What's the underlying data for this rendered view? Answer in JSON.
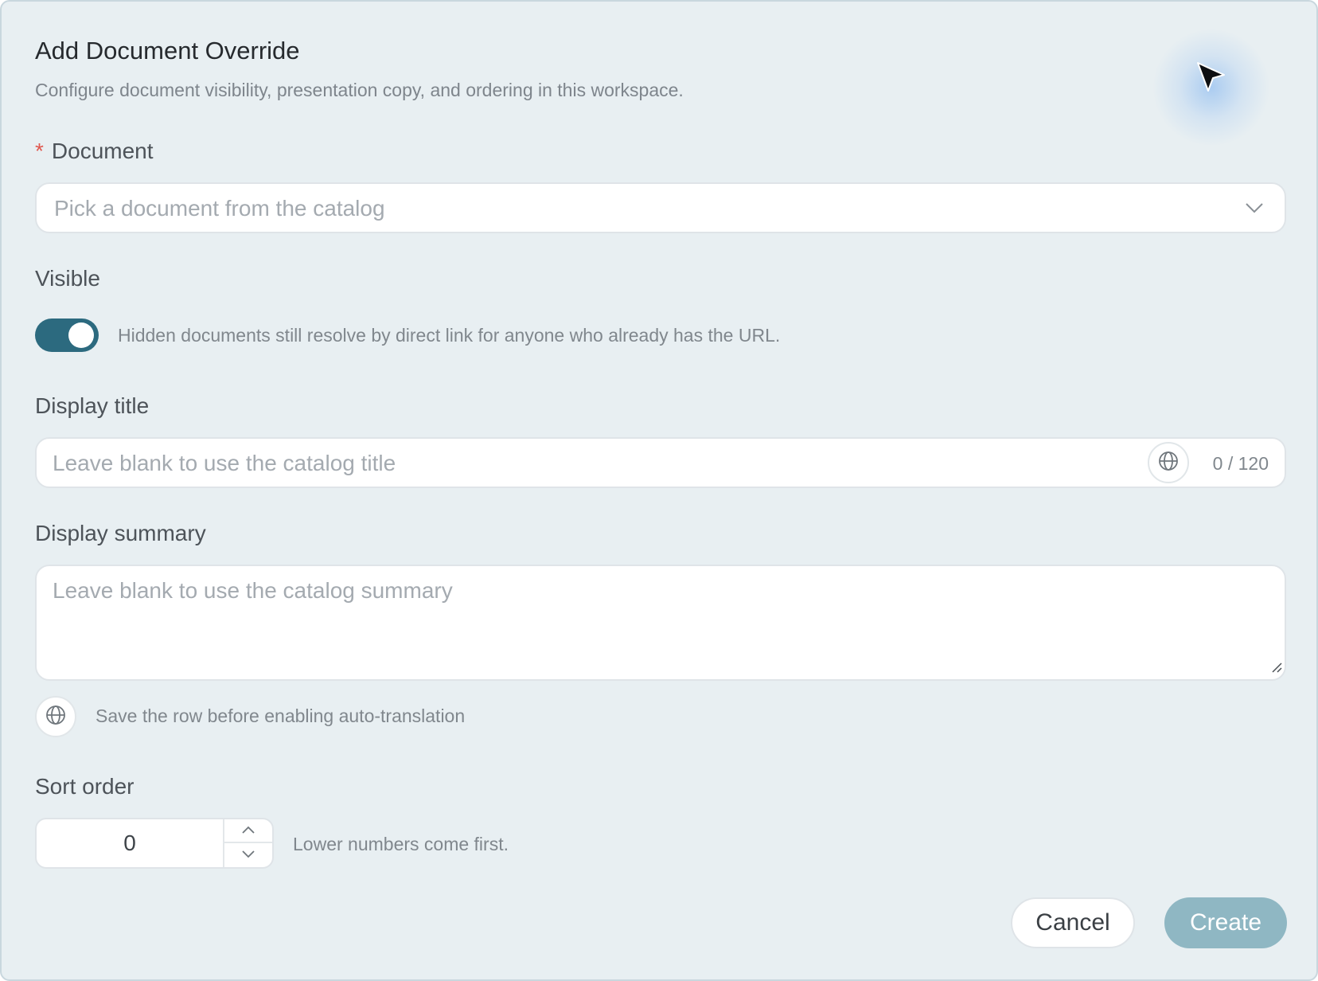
{
  "dialog": {
    "title": "Add Document Override",
    "subtitle": "Configure document visibility, presentation copy, and ordering in this workspace."
  },
  "document_field": {
    "required_marker": "*",
    "label": "Document",
    "placeholder": "Pick a document from the catalog",
    "icon": "chevron-down-icon"
  },
  "visible_field": {
    "label": "Visible",
    "enabled": true,
    "hint": "Hidden documents still resolve by direct link for anyone who already has the URL."
  },
  "display_title_field": {
    "label": "Display title",
    "placeholder": "Leave blank to use the catalog title",
    "counter": "0 / 120",
    "icon": "globe-icon"
  },
  "display_summary_field": {
    "label": "Display summary",
    "placeholder": "Leave blank to use the catalog summary",
    "translate_hint": "Save the row before enabling auto-translation",
    "icon": "globe-icon"
  },
  "sort_order_field": {
    "label": "Sort order",
    "value": "0",
    "hint": "Lower numbers come first."
  },
  "actions": {
    "cancel_label": "Cancel",
    "create_label": "Create"
  },
  "colors": {
    "dialog_background": "#e8eff2",
    "toggle_on": "#2c6a7f",
    "primary_disabled": "#8fb7c3",
    "required": "#e0584f"
  }
}
